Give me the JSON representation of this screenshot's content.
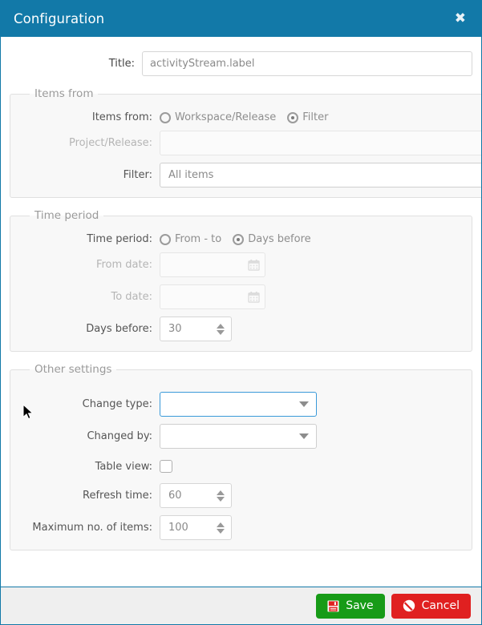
{
  "header": {
    "title": "Configuration",
    "close_label": "✖"
  },
  "title_field": {
    "label": "Title:",
    "value": "activityStream.label"
  },
  "items_from": {
    "legend": "Items from",
    "radio_label": "Items from:",
    "options": [
      {
        "label": "Workspace/Release",
        "checked": false
      },
      {
        "label": "Filter",
        "checked": true
      }
    ],
    "project_release": {
      "label": "Project/Release:",
      "value": "",
      "disabled": true
    },
    "filter": {
      "label": "Filter:",
      "value": "All items",
      "disabled": false
    }
  },
  "time_period": {
    "legend": "Time period",
    "radio_label": "Time period:",
    "options": [
      {
        "label": "From - to",
        "checked": false
      },
      {
        "label": "Days before",
        "checked": true
      }
    ],
    "from_date": {
      "label": "From date:",
      "value": "",
      "disabled": true
    },
    "to_date": {
      "label": "To date:",
      "value": "",
      "disabled": true
    },
    "days_before": {
      "label": "Days before:",
      "value": "30"
    }
  },
  "other_settings": {
    "legend": "Other settings",
    "change_type": {
      "label": "Change type:",
      "value": "",
      "focused": true
    },
    "changed_by": {
      "label": "Changed by:",
      "value": ""
    },
    "table_view": {
      "label": "Table view:",
      "checked": false
    },
    "refresh_time": {
      "label": "Refresh time:",
      "value": "60"
    },
    "max_items": {
      "label": "Maximum no. of items:",
      "value": "100"
    }
  },
  "footer": {
    "save_label": "Save",
    "cancel_label": "Cancel"
  },
  "colors": {
    "header_blue": "#1279a8",
    "focus_blue": "#3a9ad9",
    "save_green": "#179b17",
    "cancel_red": "#e02020",
    "fieldset_bg": "#f8f8f8"
  }
}
